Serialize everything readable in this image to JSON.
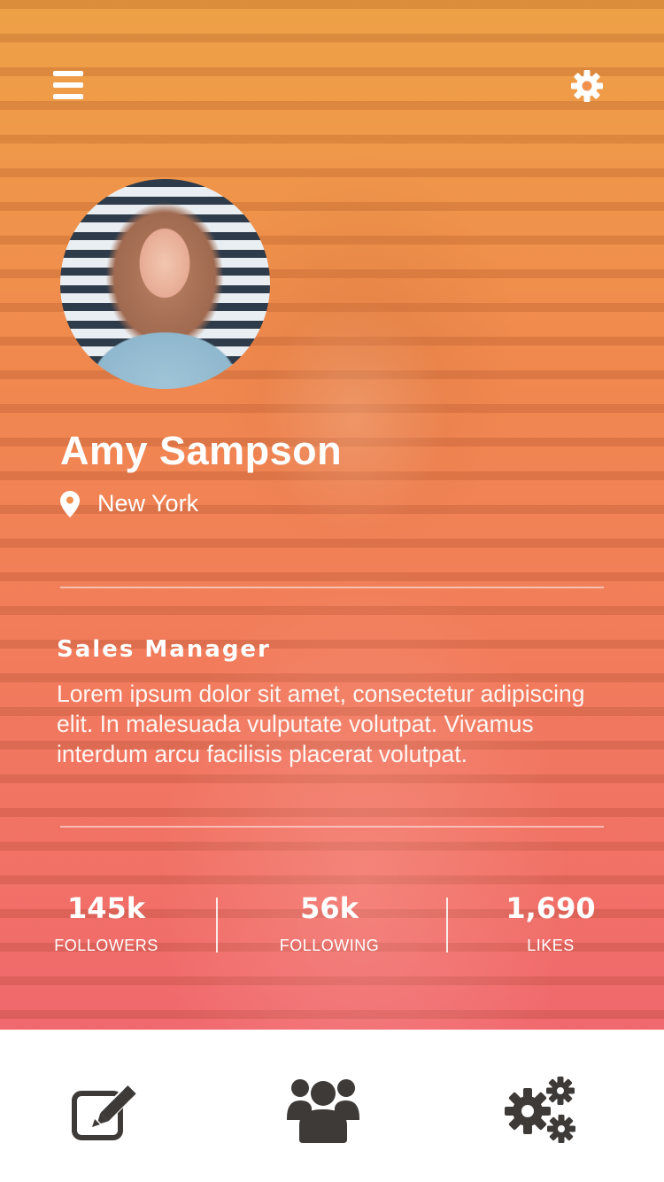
{
  "header": {
    "menu_icon": "hamburger-menu-icon",
    "settings_icon": "gear-icon"
  },
  "profile": {
    "name": "Amy Sampson",
    "location": "New York",
    "job_title": "Sales Manager",
    "bio": "Lorem ipsum dolor sit amet, consectetur adipiscing elit. In malesuada vulputate volutpat. Vivamus interdum arcu facilisis placerat volutpat."
  },
  "stats": [
    {
      "value": "145k",
      "label": "FOLLOWERS"
    },
    {
      "value": "56k",
      "label": "FOLLOWING"
    },
    {
      "value": "1,690",
      "label": "LIKES"
    }
  ],
  "tabbar": {
    "items": [
      {
        "icon": "edit-icon"
      },
      {
        "icon": "users-group-icon"
      },
      {
        "icon": "settings-gears-icon"
      }
    ]
  },
  "colors": {
    "gradient_top": "#eea64a",
    "gradient_bottom": "#f06a6e",
    "tab_icon": "#3d3a38"
  }
}
